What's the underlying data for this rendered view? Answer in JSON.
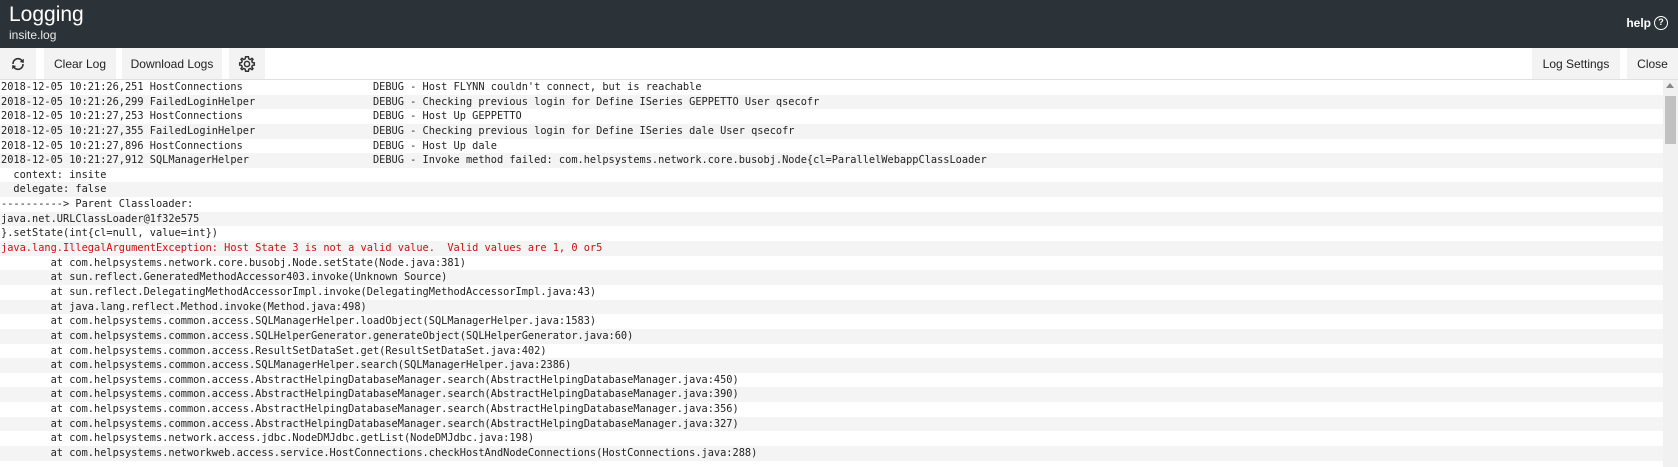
{
  "header": {
    "title": "Logging",
    "subtitle": "insite.log",
    "help_label": "help",
    "help_icon": "?"
  },
  "toolbar": {
    "refresh_icon": "refresh-icon",
    "clear_label": "Clear Log",
    "download_label": "Download Logs",
    "gear_icon": "gear-icon",
    "settings_label": "Log Settings",
    "close_label": "Close"
  },
  "colors": {
    "header_bg": "#2c3338",
    "error_text": "#cc1111"
  },
  "log": {
    "lines": [
      "2018-12-05 10:21:26,251 HostConnections                     DEBUG - Host FLYNN couldn't connect, but is reachable",
      "2018-12-05 10:21:26,299 FailedLoginHelper                   DEBUG - Checking previous login for Define ISeries GEPPETTO User qsecofr",
      "2018-12-05 10:21:27,253 HostConnections                     DEBUG - Host Up GEPPETTO",
      "2018-12-05 10:21:27,355 FailedLoginHelper                   DEBUG - Checking previous login for Define ISeries dale User qsecofr",
      "2018-12-05 10:21:27,896 HostConnections                     DEBUG - Host Up dale",
      "2018-12-05 10:21:27,912 SQLManagerHelper                    DEBUG - Invoke method failed: com.helpsystems.network.core.busobj.Node{cl=ParallelWebappClassLoader",
      "  context: insite",
      "  delegate: false",
      "----------> Parent Classloader:",
      "java.net.URLClassLoader@1f32e575",
      "}.setState(int{cl=null, value=int})",
      "java.lang.IllegalArgumentException: Host State 3 is not a valid value.  Valid values are 1, 0 or5",
      "        at com.helpsystems.network.core.busobj.Node.setState(Node.java:381)",
      "        at sun.reflect.GeneratedMethodAccessor403.invoke(Unknown Source)",
      "        at sun.reflect.DelegatingMethodAccessorImpl.invoke(DelegatingMethodAccessorImpl.java:43)",
      "        at java.lang.reflect.Method.invoke(Method.java:498)",
      "        at com.helpsystems.common.access.SQLManagerHelper.loadObject(SQLManagerHelper.java:1583)",
      "        at com.helpsystems.common.access.SQLHelperGenerator.generateObject(SQLHelperGenerator.java:60)",
      "        at com.helpsystems.common.access.ResultSetDataSet.get(ResultSetDataSet.java:402)",
      "        at com.helpsystems.common.access.SQLManagerHelper.search(SQLManagerHelper.java:2386)",
      "        at com.helpsystems.common.access.AbstractHelpingDatabaseManager.search(AbstractHelpingDatabaseManager.java:450)",
      "        at com.helpsystems.common.access.AbstractHelpingDatabaseManager.search(AbstractHelpingDatabaseManager.java:390)",
      "        at com.helpsystems.common.access.AbstractHelpingDatabaseManager.search(AbstractHelpingDatabaseManager.java:356)",
      "        at com.helpsystems.common.access.AbstractHelpingDatabaseManager.search(AbstractHelpingDatabaseManager.java:327)",
      "        at com.helpsystems.network.access.jdbc.NodeDMJdbc.getList(NodeDMJdbc.java:198)",
      "        at com.helpsystems.networkweb.access.service.HostConnections.checkHostAndNodeConnections(HostConnections.java:288)"
    ],
    "error_line_index": 11
  }
}
